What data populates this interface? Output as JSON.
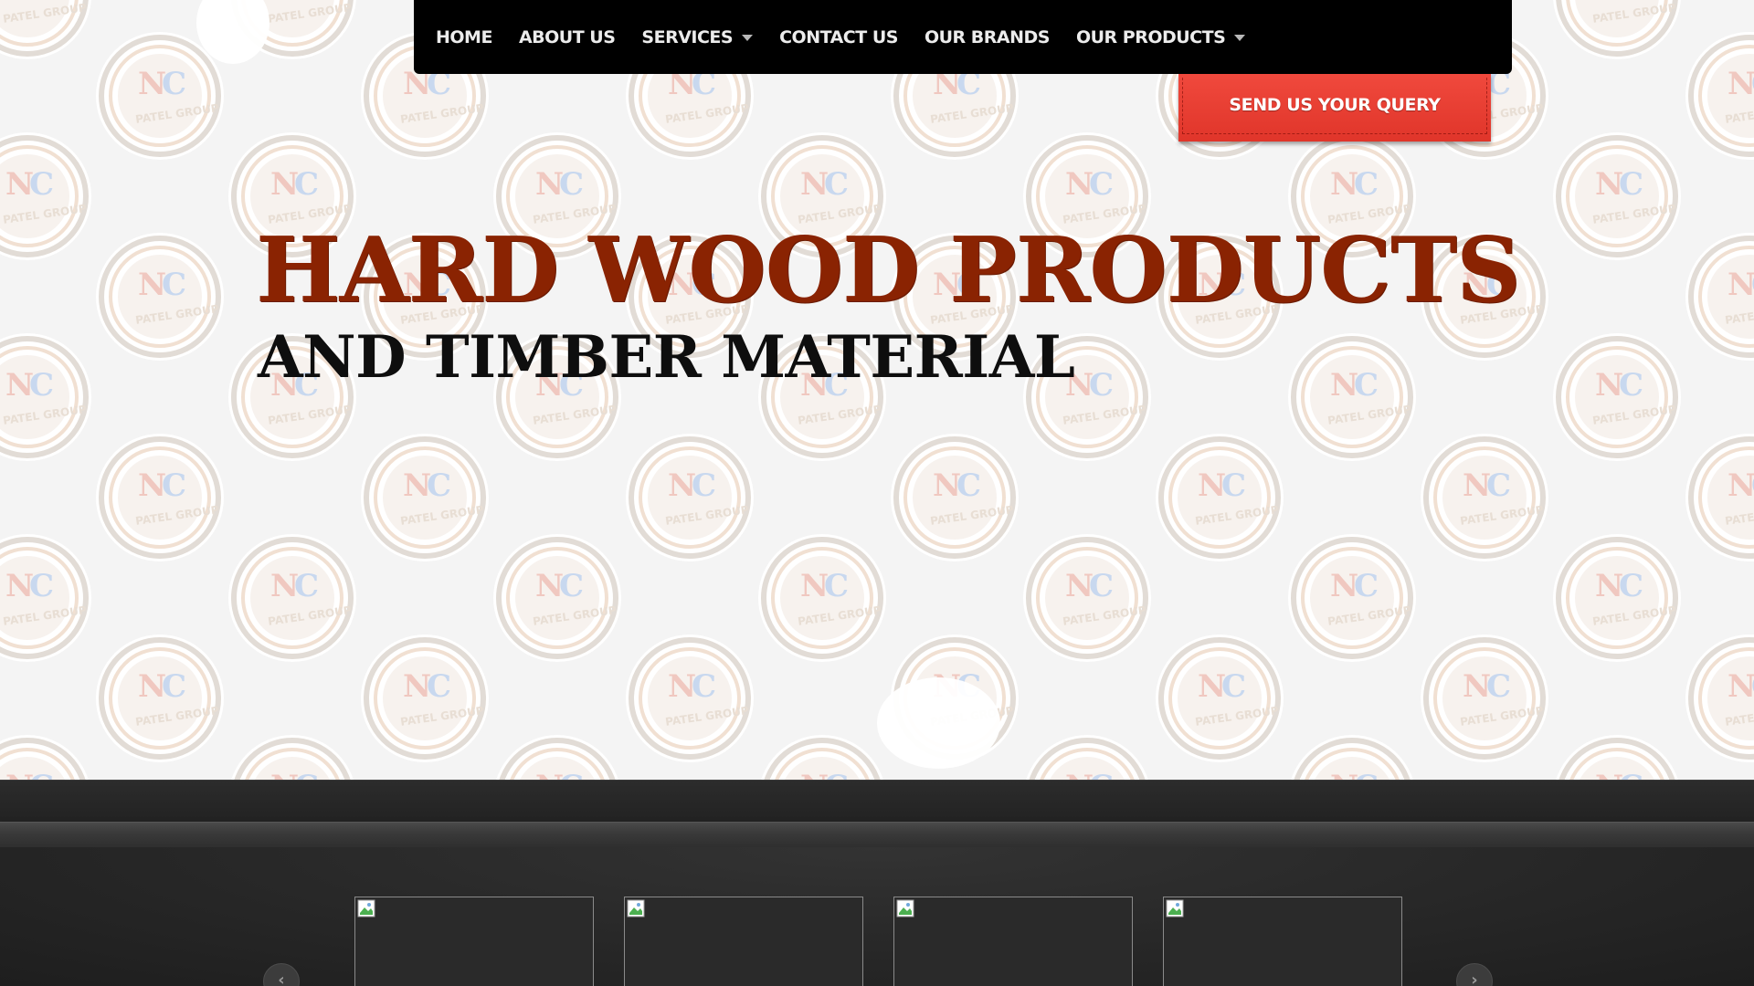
{
  "nav": {
    "items": [
      {
        "label": "HOME",
        "has_dropdown": false
      },
      {
        "label": "ABOUT US",
        "has_dropdown": false
      },
      {
        "label": "SERVICES",
        "has_dropdown": true
      },
      {
        "label": "CONTACT US",
        "has_dropdown": false
      },
      {
        "label": "OUR BRANDS",
        "has_dropdown": false
      },
      {
        "label": "OUR PRODUCTS",
        "has_dropdown": true
      }
    ]
  },
  "query_button": {
    "label": "SEND US YOUR QUERY"
  },
  "hero": {
    "headline": "HARD WOOD PRODUCTS",
    "subheadline": "AND TIMBER MATERIAL",
    "watermark_logo_text_top": "NC",
    "watermark_logo_text_bottom": "PATEL GROUP"
  },
  "carousel": {
    "thumbnails": [
      {
        "icon": "broken-image-icon"
      },
      {
        "icon": "broken-image-icon"
      },
      {
        "icon": "broken-image-icon"
      },
      {
        "icon": "broken-image-icon"
      }
    ],
    "prev_icon": "chevron-left-icon",
    "next_icon": "chevron-right-icon"
  },
  "colors": {
    "nav_bg": "#000000",
    "query_red": "#e83b30",
    "headline_brown": "#8a2302",
    "subheadline_black": "#0e0e0e",
    "dark_section": "#262626"
  }
}
